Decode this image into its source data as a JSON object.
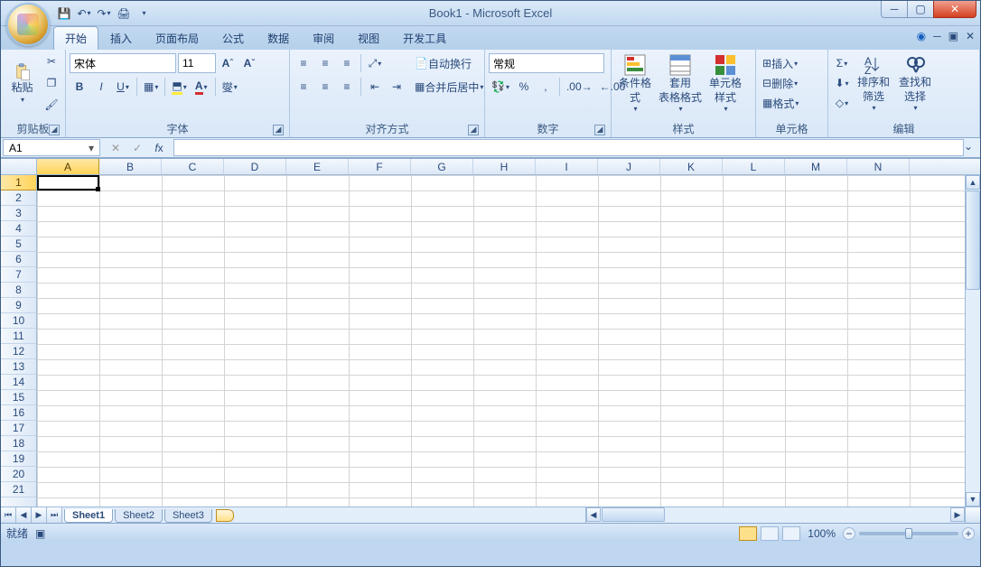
{
  "title": "Book1 - Microsoft Excel",
  "tabs": [
    "开始",
    "插入",
    "页面布局",
    "公式",
    "数据",
    "审阅",
    "视图",
    "开发工具"
  ],
  "active_tab": 0,
  "ribbon": {
    "clipboard": {
      "label": "剪贴板",
      "paste": "粘贴"
    },
    "font": {
      "label": "字体",
      "name": "宋体",
      "size": "11"
    },
    "alignment": {
      "label": "对齐方式",
      "wrap": "自动换行",
      "merge": "合并后居中"
    },
    "number": {
      "label": "数字",
      "format": "常规"
    },
    "styles": {
      "label": "样式",
      "cond": "条件格式",
      "table": "套用\n表格格式",
      "cell": "单元格\n样式"
    },
    "cells": {
      "label": "单元格",
      "insert": "插入",
      "delete": "删除",
      "format": "格式"
    },
    "editing": {
      "label": "编辑",
      "sort": "排序和\n筛选",
      "find": "查找和\n选择"
    }
  },
  "namebox": "A1",
  "columns": [
    "A",
    "B",
    "C",
    "D",
    "E",
    "F",
    "G",
    "H",
    "I",
    "J",
    "K",
    "L",
    "M",
    "N"
  ],
  "rows": 21,
  "selected": {
    "col": 0,
    "row": 0
  },
  "sheets": [
    "Sheet1",
    "Sheet2",
    "Sheet3"
  ],
  "active_sheet": 0,
  "status": {
    "ready": "就绪",
    "zoom": "100%"
  }
}
